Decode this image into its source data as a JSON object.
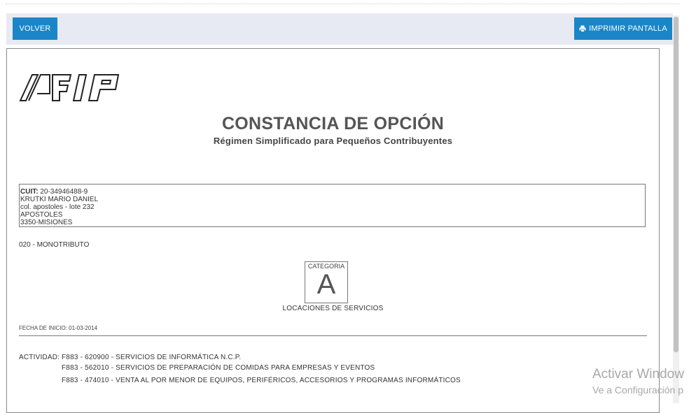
{
  "toolbar": {
    "back_label": "VOLVER",
    "print_label": "IMPRIMIR PANTALLA"
  },
  "document": {
    "title": "CONSTANCIA DE OPCIÓN",
    "subtitle": "Régimen Simplificado para Pequeños Contribuyentes",
    "cuit_label": "CUIT:",
    "cuit_value": "20-34946488-9",
    "name": "KRUTKI MARIO DANIEL",
    "address": "col. apostoles - lote 232",
    "city": "APOSTOLES",
    "zip_province": "3350-MISIONES",
    "regimen": "020 - MONOTRIBUTO",
    "category_label": "CATEGORIA",
    "category": "A",
    "category_desc": "LOCACIONES DE SERVICIOS",
    "start_date": "FECHA DE INICIO: 01-03-2014",
    "activity_label": "ACTIVIDAD:",
    "activities": [
      "F883 - 620900 - SERVICIOS DE INFORMÁTICA N.C.P.",
      "F883 - 562010 - SERVICIOS DE PREPARACIÓN DE COMIDAS PARA EMPRESAS Y EVENTOS",
      "F883 - 474010 - VENTA AL POR MENOR DE EQUIPOS, PERIFÉRICOS, ACCESORIOS Y PROGRAMAS INFORMÁTICOS"
    ]
  },
  "watermark": {
    "line1": "Activar Window",
    "line2": "Ve a Configuración p"
  },
  "colors": {
    "button_bg": "#1a86c8",
    "toolbar_bg": "#e8eaf3"
  },
  "icons": {
    "print": "printer-icon",
    "logo": "afip-logo"
  }
}
